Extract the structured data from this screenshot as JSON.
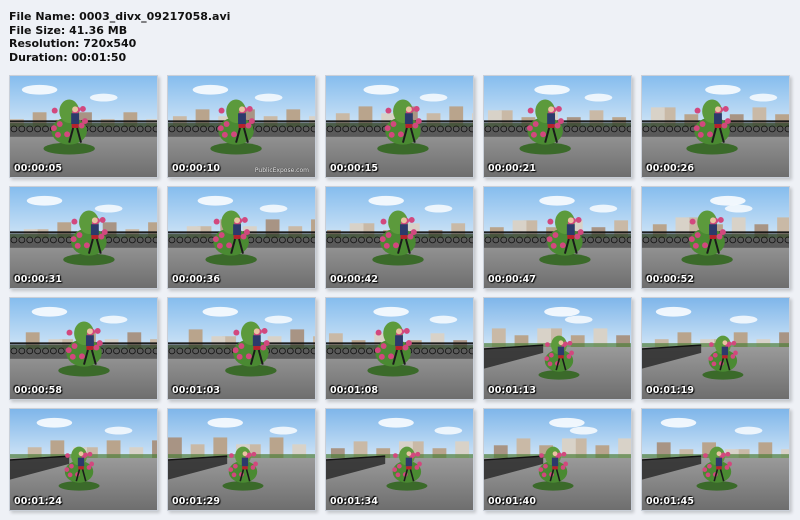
{
  "file_info": {
    "file_name": "File Name: 0003_divx_09217058.avi",
    "file_size": "File Size: 41.36 MB",
    "resolution": "Resolution: 720x540",
    "duration": "Duration: 00:01:50"
  },
  "watermark": "PublicExpose.com",
  "colors": {
    "page_background": "#eef1f6",
    "sky": "#8fc3ee",
    "pavement": "#8c8c8c",
    "flowers": "#d2487e",
    "foliage": "#3d7a2a"
  },
  "thumbnails": [
    {
      "time": "00:00:05",
      "view": "planter"
    },
    {
      "time": "00:00:10",
      "view": "planter"
    },
    {
      "time": "00:00:15",
      "view": "planter"
    },
    {
      "time": "00:00:21",
      "view": "planter"
    },
    {
      "time": "00:00:26",
      "view": "planter"
    },
    {
      "time": "00:00:31",
      "view": "planter"
    },
    {
      "time": "00:00:36",
      "view": "planter"
    },
    {
      "time": "00:00:42",
      "view": "planter"
    },
    {
      "time": "00:00:47",
      "view": "planter"
    },
    {
      "time": "00:00:52",
      "view": "planter"
    },
    {
      "time": "00:00:58",
      "view": "planter"
    },
    {
      "time": "00:01:03",
      "view": "planter"
    },
    {
      "time": "00:01:08",
      "view": "planter"
    },
    {
      "time": "00:01:13",
      "view": "wide"
    },
    {
      "time": "00:01:19",
      "view": "wide"
    },
    {
      "time": "00:01:24",
      "view": "wide"
    },
    {
      "time": "00:01:29",
      "view": "wide"
    },
    {
      "time": "00:01:34",
      "view": "wide"
    },
    {
      "time": "00:01:40",
      "view": "wide"
    },
    {
      "time": "00:01:45",
      "view": "wide"
    }
  ]
}
